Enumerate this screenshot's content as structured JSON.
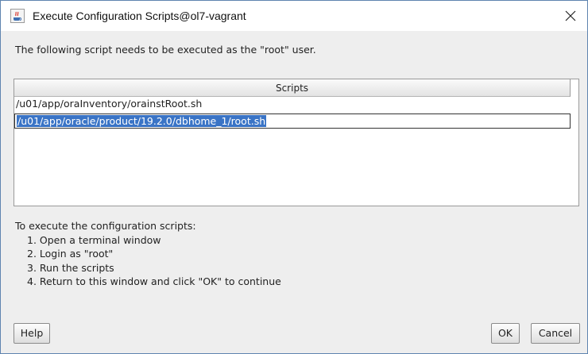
{
  "window": {
    "title": "Execute Configuration Scripts@ol7-vagrant",
    "app_icon": "java-coffee-cup-icon",
    "close_icon": "close-icon"
  },
  "intro_text": "The following script needs to be executed as the \"root\" user.",
  "scripts_table": {
    "header": "Scripts",
    "rows": [
      "/u01/app/oraInventory/orainstRoot.sh",
      "/u01/app/oracle/product/19.2.0/dbhome_1/root.sh"
    ],
    "selected_row_index": 1
  },
  "instructions": {
    "heading": "To execute the configuration scripts:",
    "steps": [
      "1. Open a terminal window",
      "2. Login as \"root\"",
      "3. Run the scripts",
      "4. Return to this window and click \"OK\" to continue"
    ]
  },
  "buttons": {
    "help": "Help",
    "ok": "OK",
    "cancel": "Cancel"
  },
  "colors": {
    "selection": "#3a74c6",
    "window_border": "#5f84b0"
  }
}
